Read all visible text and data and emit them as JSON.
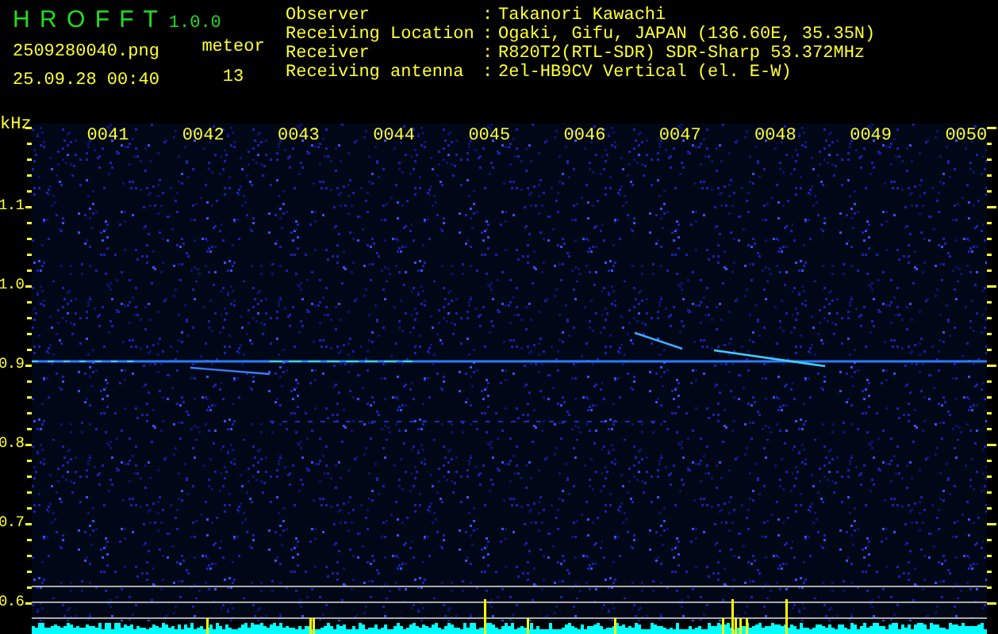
{
  "app": {
    "title": "H R O F F T",
    "version": "1.0.0"
  },
  "file": {
    "name": "2509280040.png",
    "datetime": "25.09.28 00:40"
  },
  "meteor": {
    "label": "meteor",
    "count": "13"
  },
  "info": [
    {
      "label": "Observer",
      "separator": ":",
      "value": "Takanori Kawachi"
    },
    {
      "label": "Receiving Location",
      "separator": ":",
      "value": "Ogaki, Gifu, JAPAN (136.60E, 35.35N)"
    },
    {
      "label": "Receiver",
      "separator": ":",
      "value": "R820T2(RTL-SDR) SDR-Sharp 53.372MHz"
    },
    {
      "label": "Receiving antenna",
      "separator": ":",
      "value": "2el-HB9CV Vertical (el. E-W)"
    }
  ],
  "axis": {
    "unit": "kHz",
    "frequencies": [
      "1.1",
      "1.0",
      "0.9",
      "0.8",
      "0.7",
      "0.6"
    ],
    "times": [
      "0041",
      "0042",
      "0043",
      "0044",
      "0045",
      "0046",
      "0047",
      "0048",
      "0049",
      "0050"
    ]
  }
}
